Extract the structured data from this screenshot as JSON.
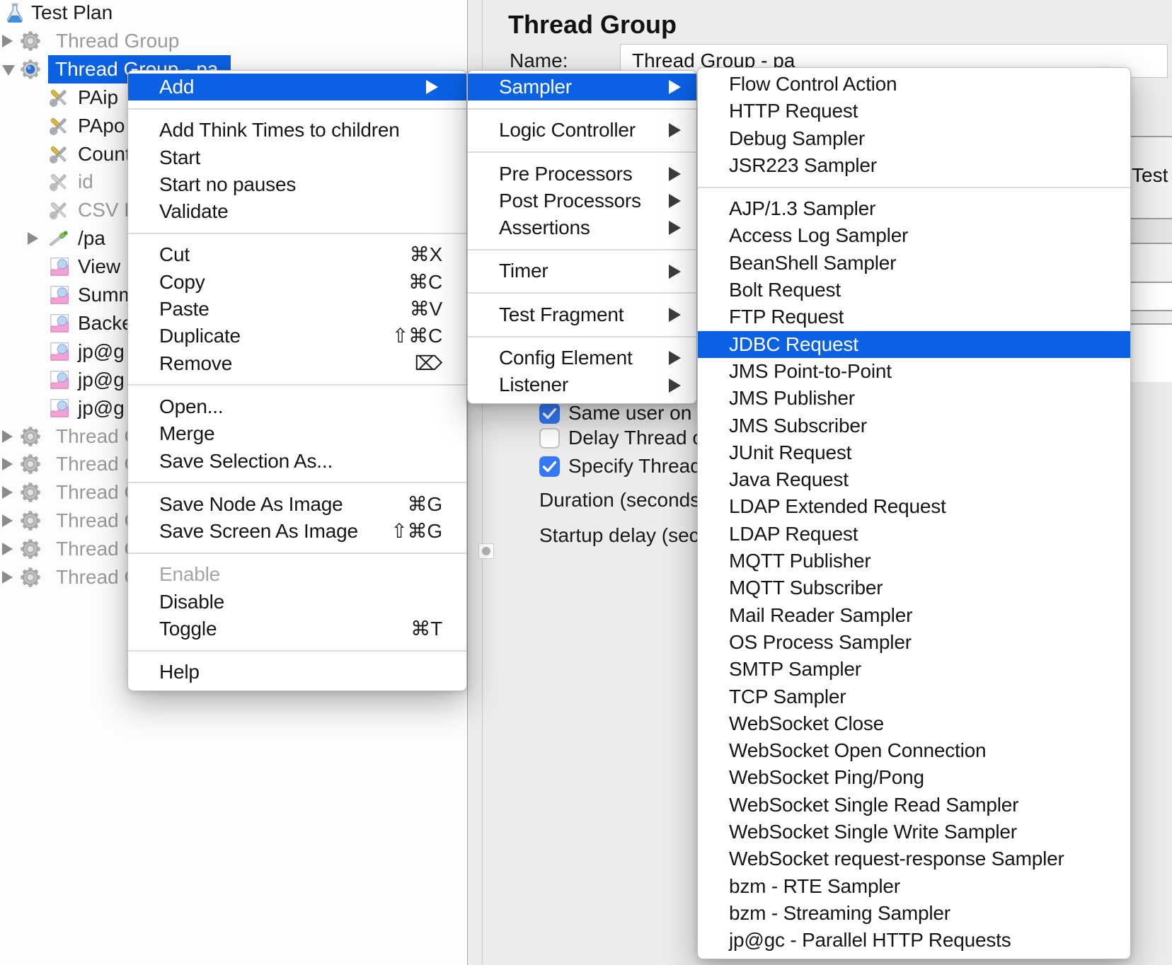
{
  "app": {
    "selection_color": "#0b61e4"
  },
  "tree": {
    "items": [
      {
        "label": "Test Plan",
        "icon": "test-plan-flask-icon",
        "level": 0,
        "arrow": "none",
        "state": "normal"
      },
      {
        "label": "Thread Group",
        "icon": "gear-icon",
        "level": 1,
        "arrow": "collapsed",
        "state": "disabled"
      },
      {
        "label": "Thread Group - pa",
        "icon": "gear-active-icon",
        "level": 1,
        "arrow": "expanded",
        "state": "selected"
      },
      {
        "label": "PAip",
        "icon": "tools-icon",
        "level": 2,
        "arrow": "none",
        "state": "normal"
      },
      {
        "label": "PApo",
        "icon": "tools-icon",
        "level": 2,
        "arrow": "none",
        "state": "normal"
      },
      {
        "label": "Count",
        "icon": "tools-icon",
        "level": 2,
        "arrow": "none",
        "state": "normal"
      },
      {
        "label": "id",
        "icon": "tools-disabled-icon",
        "level": 2,
        "arrow": "none",
        "state": "disabled"
      },
      {
        "label": "CSV D",
        "icon": "tools-disabled-icon",
        "level": 2,
        "arrow": "none",
        "state": "disabled"
      },
      {
        "label": "/pa",
        "icon": "dropper-icon",
        "level": 2,
        "arrow": "collapsed",
        "state": "normal"
      },
      {
        "label": "View",
        "icon": "chart-icon",
        "level": 2,
        "arrow": "none",
        "state": "normal"
      },
      {
        "label": "Summ",
        "icon": "chart-icon",
        "level": 2,
        "arrow": "none",
        "state": "normal"
      },
      {
        "label": "Backe",
        "icon": "chart-icon",
        "level": 2,
        "arrow": "none",
        "state": "normal"
      },
      {
        "label": "jp@g",
        "icon": "chart-icon",
        "level": 2,
        "arrow": "none",
        "state": "normal"
      },
      {
        "label": "jp@g",
        "icon": "chart-icon",
        "level": 2,
        "arrow": "none",
        "state": "normal"
      },
      {
        "label": "jp@g",
        "icon": "chart-icon",
        "level": 2,
        "arrow": "none",
        "state": "normal"
      },
      {
        "label": "Thread G",
        "icon": "gear-icon",
        "level": 1,
        "arrow": "collapsed",
        "state": "disabled"
      },
      {
        "label": "Thread G",
        "icon": "gear-icon",
        "level": 1,
        "arrow": "collapsed",
        "state": "disabled"
      },
      {
        "label": "Thread G",
        "icon": "gear-icon",
        "level": 1,
        "arrow": "collapsed",
        "state": "disabled"
      },
      {
        "label": "Thread G",
        "icon": "gear-icon",
        "level": 1,
        "arrow": "collapsed",
        "state": "disabled"
      },
      {
        "label": "Thread G",
        "icon": "gear-icon",
        "level": 1,
        "arrow": "collapsed",
        "state": "disabled"
      },
      {
        "label": "Thread G",
        "icon": "gear-icon",
        "level": 1,
        "arrow": "collapsed",
        "state": "disabled"
      }
    ]
  },
  "panel": {
    "title": "Thread Group",
    "name_label": "Name:",
    "name_value": "Thread Group - pa",
    "rows": [
      {
        "type": "checkbox",
        "label": "Same user on e",
        "checked": true
      },
      {
        "type": "checkbox",
        "label": "Delay Thread c",
        "checked": false
      },
      {
        "type": "checkbox",
        "label": "Specify Thread",
        "checked": true
      },
      {
        "type": "label",
        "label": "Duration (seconds",
        "checked": false
      },
      {
        "type": "label",
        "label": "Startup delay (sec",
        "checked": false
      }
    ],
    "sliver_text": "Test"
  },
  "context_menu": {
    "items": [
      {
        "label": "Add",
        "submenu": true,
        "highlighted": true
      },
      {
        "type": "separator"
      },
      {
        "label": "Add Think Times to children"
      },
      {
        "label": "Start"
      },
      {
        "label": "Start no pauses"
      },
      {
        "label": "Validate"
      },
      {
        "type": "separator"
      },
      {
        "label": "Cut",
        "shortcut": "⌘X"
      },
      {
        "label": "Copy",
        "shortcut": "⌘C"
      },
      {
        "label": "Paste",
        "shortcut": "⌘V"
      },
      {
        "label": "Duplicate",
        "shortcut": "⇧⌘C"
      },
      {
        "label": "Remove",
        "shortcut": "⌦"
      },
      {
        "type": "separator"
      },
      {
        "label": "Open..."
      },
      {
        "label": "Merge"
      },
      {
        "label": "Save Selection As..."
      },
      {
        "type": "separator"
      },
      {
        "label": "Save Node As Image",
        "shortcut": "⌘G"
      },
      {
        "label": "Save Screen As Image",
        "shortcut": "⇧⌘G"
      },
      {
        "type": "separator"
      },
      {
        "label": "Enable",
        "disabled": true
      },
      {
        "label": "Disable"
      },
      {
        "label": "Toggle",
        "shortcut": "⌘T"
      },
      {
        "type": "separator"
      },
      {
        "label": "Help"
      }
    ]
  },
  "add_submenu": {
    "items": [
      {
        "label": "Sampler",
        "submenu": true,
        "highlighted": true
      },
      {
        "type": "separator"
      },
      {
        "label": "Logic Controller",
        "submenu": true
      },
      {
        "type": "separator"
      },
      {
        "label": "Pre Processors",
        "submenu": true
      },
      {
        "label": "Post Processors",
        "submenu": true
      },
      {
        "label": "Assertions",
        "submenu": true
      },
      {
        "type": "separator"
      },
      {
        "label": "Timer",
        "submenu": true
      },
      {
        "type": "separator"
      },
      {
        "label": "Test Fragment",
        "submenu": true
      },
      {
        "type": "separator"
      },
      {
        "label": "Config Element",
        "submenu": true
      },
      {
        "label": "Listener",
        "submenu": true
      }
    ]
  },
  "sampler_submenu": {
    "items": [
      {
        "label": "Flow Control Action"
      },
      {
        "label": "HTTP Request"
      },
      {
        "label": "Debug Sampler"
      },
      {
        "label": "JSR223 Sampler"
      },
      {
        "type": "separator"
      },
      {
        "label": "AJP/1.3 Sampler"
      },
      {
        "label": "Access Log Sampler"
      },
      {
        "label": "BeanShell Sampler"
      },
      {
        "label": "Bolt Request"
      },
      {
        "label": "FTP Request"
      },
      {
        "label": "JDBC Request",
        "highlighted": true
      },
      {
        "label": "JMS Point-to-Point"
      },
      {
        "label": "JMS Publisher"
      },
      {
        "label": "JMS Subscriber"
      },
      {
        "label": "JUnit Request"
      },
      {
        "label": "Java Request"
      },
      {
        "label": "LDAP Extended Request"
      },
      {
        "label": "LDAP Request"
      },
      {
        "label": "MQTT Publisher"
      },
      {
        "label": "MQTT Subscriber"
      },
      {
        "label": "Mail Reader Sampler"
      },
      {
        "label": "OS Process Sampler"
      },
      {
        "label": "SMTP Sampler"
      },
      {
        "label": "TCP Sampler"
      },
      {
        "label": "WebSocket Close"
      },
      {
        "label": "WebSocket Open Connection"
      },
      {
        "label": "WebSocket Ping/Pong"
      },
      {
        "label": "WebSocket Single Read Sampler"
      },
      {
        "label": "WebSocket Single Write Sampler"
      },
      {
        "label": "WebSocket request-response Sampler"
      },
      {
        "label": "bzm - RTE Sampler"
      },
      {
        "label": "bzm - Streaming Sampler"
      },
      {
        "label": "jp@gc - Parallel HTTP Requests"
      }
    ]
  }
}
